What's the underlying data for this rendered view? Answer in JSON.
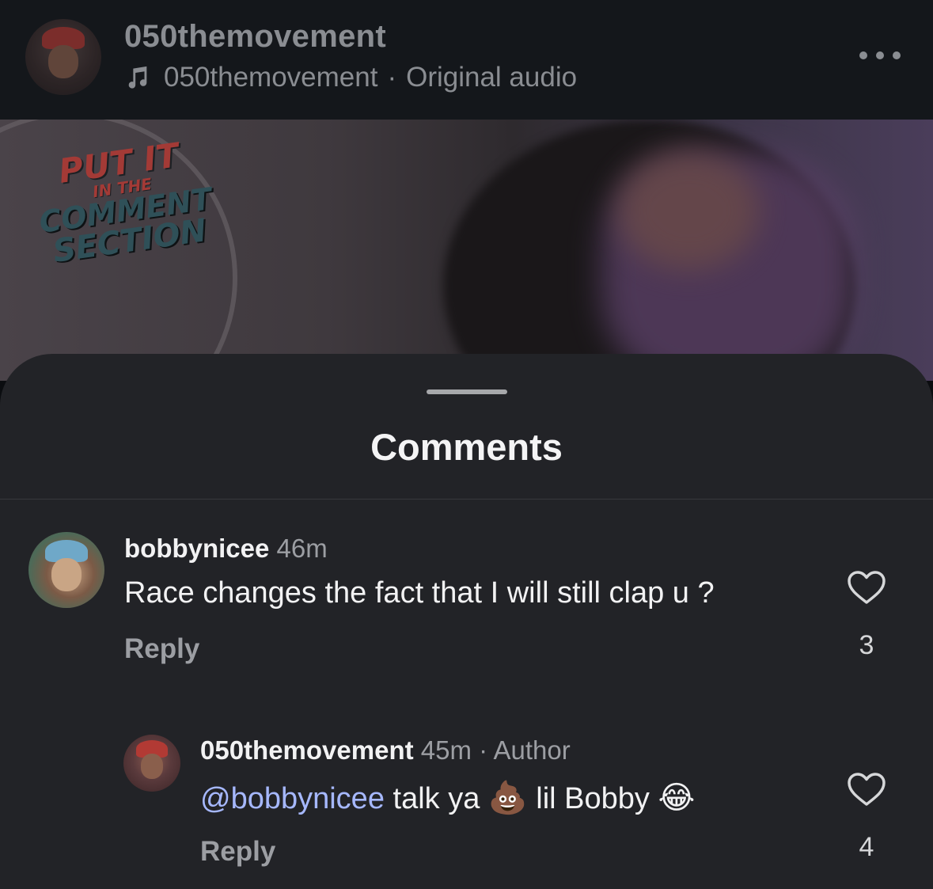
{
  "header": {
    "username": "050themovement",
    "audio_owner": "050themovement",
    "audio_separator": "·",
    "audio_label": "Original audio",
    "more_icon": "more-horizontal-icon",
    "music_icon": "music-note-icon"
  },
  "video": {
    "logo_lines": [
      "PUT IT",
      "IN THE",
      "COMMENT",
      "SECTION"
    ]
  },
  "sheet": {
    "title": "Comments"
  },
  "comments": [
    {
      "username": "bobbynicee",
      "time": "46m",
      "text": "Race changes the fact that I will still clap u ?",
      "reply_label": "Reply",
      "likes": "3"
    },
    {
      "username": "050themovement",
      "time": "45m",
      "separator": "·",
      "badge": "Author",
      "mention": "@bobbynicee",
      "text_part1": "talk ya",
      "emoji1": "💩",
      "text_part2": "lil Bobby",
      "emoji2": "😂",
      "reply_label": "Reply",
      "likes": "4"
    }
  ],
  "colors": {
    "sheet_bg": "#222327",
    "header_bg": "#14171b",
    "mention": "#a6b8ff",
    "muted_text": "#9c9ea3"
  }
}
